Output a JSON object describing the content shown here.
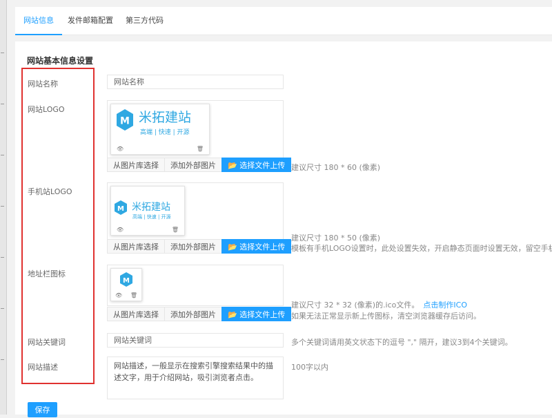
{
  "tabs": [
    {
      "label": "网站信息",
      "active": true
    },
    {
      "label": "发件邮箱配置",
      "active": false
    },
    {
      "label": "第三方代码",
      "active": false
    }
  ],
  "section_title": "网站基本信息设置",
  "fields": {
    "site_name": {
      "label": "网站名称",
      "placeholder": "网站名称"
    },
    "site_logo": {
      "label": "网站LOGO",
      "hint": "建议尺寸 180 * 60 (像素)"
    },
    "mobile_logo": {
      "label": "手机站LOGO",
      "hint_line1": "建议尺寸 180 * 50 (像素)",
      "hint_line2": "模板有手机LOGO设置时，此处设置失效，开启静态页面时设置无效，留空手机端使"
    },
    "favicon": {
      "label": "地址栏图标",
      "hint_line1": "建议尺寸 32 * 32 (像素)的.ico文件。",
      "hint_link": "点击制作ICO",
      "hint_line2": "如果无法正常显示新上传图标，清空浏览器缓存后访问。"
    },
    "keywords": {
      "label": "网站关键词",
      "placeholder": "网站关键词",
      "hint": "多个关键词请用英文状态下的逗号 \",\" 隔开，建议3到4个关键词。"
    },
    "description": {
      "label": "网站描述",
      "value": "网站描述，一般显示在搜索引擎搜索结果中的描述文字，用于介绍网站，吸引浏览者点击。",
      "hint": "100字以内"
    }
  },
  "upload_buttons": {
    "library": "从图片库选择",
    "external": "添加外部图片",
    "upload": "选择文件上传"
  },
  "logo_brand": {
    "name": "米拓建站",
    "tagline": "高端 | 快速 | 开源",
    "mark": "M"
  },
  "save_label": "保存",
  "colors": {
    "accent": "#1e9fff",
    "brand": "#2fa8e2",
    "highlight_box": "#e0312f"
  }
}
